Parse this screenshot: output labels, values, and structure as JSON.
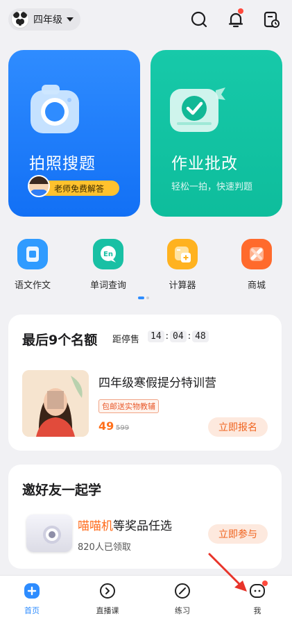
{
  "header": {
    "grade": "四年级",
    "icons": [
      "search-icon",
      "notification-bell-icon",
      "history-icon"
    ]
  },
  "hero": {
    "photo_search": {
      "title": "拍照搜题",
      "badge": "老师免费解答"
    },
    "homework_check": {
      "title": "作业批改",
      "subtitle": "轻松一拍，快速判题"
    }
  },
  "tools": [
    {
      "label": "语文作文",
      "icon": "composition-icon",
      "color": "#2f9bff"
    },
    {
      "label": "单词查询",
      "icon": "word-lookup-icon",
      "color": "#19c0a4"
    },
    {
      "label": "计算器",
      "icon": "calculator-icon",
      "color": "#ffb21f"
    },
    {
      "label": "商城",
      "icon": "store-icon",
      "color": "#ff6a2c"
    }
  ],
  "promo": {
    "title": "最后9个名额",
    "countdown_label": "距停售",
    "countdown": {
      "h": "14",
      "m": "04",
      "s": "48",
      "sep": ":"
    },
    "course_name": "四年级寒假提分特训营",
    "tag": "包邮送实物教辅",
    "price": "49",
    "old_price": "599",
    "cta": "立即报名"
  },
  "invite": {
    "title": "邀好友一起学",
    "prize_accent": "喵喵机",
    "prize_rest": "等奖品任选",
    "claimed": "820人已领取",
    "cta": "立即参与"
  },
  "tabbar": {
    "items": [
      {
        "label": "首页",
        "icon": "home-icon",
        "active": true
      },
      {
        "label": "直播课",
        "icon": "live-class-icon",
        "active": false
      },
      {
        "label": "练习",
        "icon": "practice-icon",
        "active": false
      },
      {
        "label": "我",
        "icon": "profile-icon",
        "active": false
      }
    ]
  },
  "colors": {
    "accent_blue": "#2d8cff",
    "accent_green": "#14c4a3",
    "accent_orange": "#ff6a1a"
  }
}
